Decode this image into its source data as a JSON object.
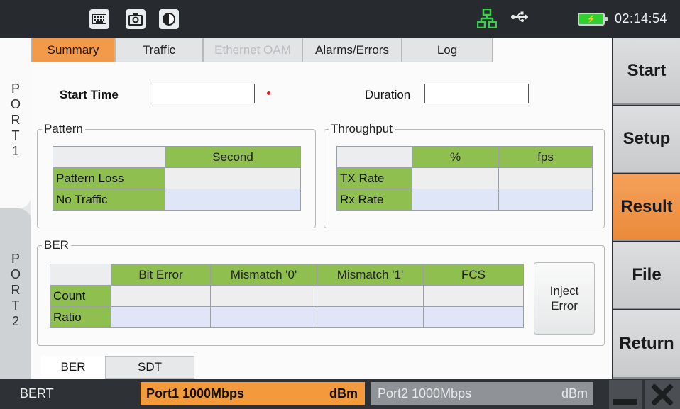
{
  "statusbar": {
    "time": "02:14:54"
  },
  "ports": {
    "port1_label": "PORT1",
    "port2_label": "PORT2"
  },
  "tabs": [
    {
      "label": "Summary",
      "state": "active"
    },
    {
      "label": "Traffic",
      "state": "normal"
    },
    {
      "label": "Ethernet OAM",
      "state": "disabled"
    },
    {
      "label": "Alarms/Errors",
      "state": "normal"
    },
    {
      "label": "Log",
      "state": "normal"
    }
  ],
  "form": {
    "start_time_label": "Start Time",
    "start_time_value": "",
    "duration_label": "Duration",
    "duration_value": ""
  },
  "pattern": {
    "title": "Pattern",
    "header": [
      "",
      "Second"
    ],
    "rows": [
      {
        "label": "Pattern Loss",
        "value": ""
      },
      {
        "label": "No Traffic",
        "value": ""
      }
    ]
  },
  "throughput": {
    "title": "Throughput",
    "header": [
      "",
      "%",
      "fps"
    ],
    "rows": [
      {
        "label": "TX Rate",
        "pct": "",
        "fps": ""
      },
      {
        "label": "Rx Rate",
        "pct": "",
        "fps": ""
      }
    ]
  },
  "ber": {
    "title": "BER",
    "header": [
      "",
      "Bit Error",
      "Mismatch '0'",
      "Mismatch '1'",
      "FCS"
    ],
    "rows": [
      {
        "label": "Count",
        "bit_error": "",
        "mismatch0": "",
        "mismatch1": "",
        "fcs": ""
      },
      {
        "label": "Ratio",
        "bit_error": "",
        "mismatch0": "",
        "mismatch1": "",
        "fcs": ""
      }
    ],
    "inject_label": "Inject Error"
  },
  "bottom_tabs": [
    "BER",
    "SDT"
  ],
  "side_buttons": [
    {
      "label": "Start",
      "state": "normal"
    },
    {
      "label": "Setup",
      "state": "normal"
    },
    {
      "label": "Result",
      "state": "active"
    },
    {
      "label": "File",
      "state": "normal"
    },
    {
      "label": "Return",
      "state": "normal"
    }
  ],
  "bottombar": {
    "mode": "BERT",
    "port1": "Port1 1000Mbps",
    "port1_unit": "dBm",
    "port2": "Port2  1000Mbps",
    "port2_unit": "dBm"
  },
  "icons": [
    "keyboard-icon",
    "screenshot-icon",
    "contrast-icon",
    "network-icon",
    "usb-icon",
    "battery-icon",
    "minimize-icon",
    "close-icon"
  ],
  "colors": {
    "accent": "#f39a4a",
    "table_header": "#8fc04f",
    "topbar": "#272b2f"
  }
}
